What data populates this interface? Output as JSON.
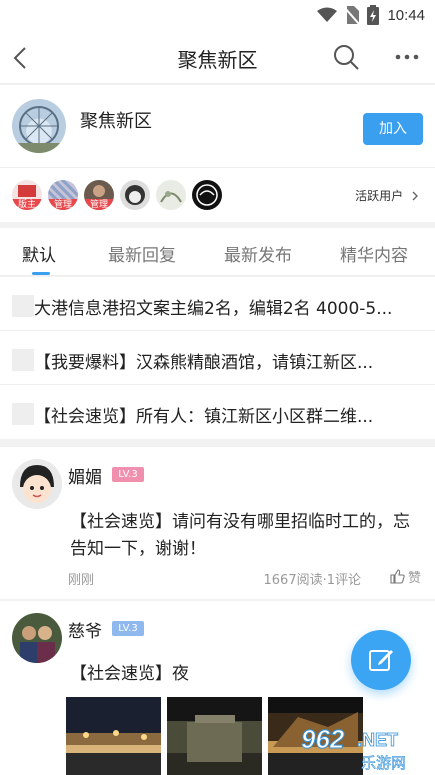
{
  "status_bar": {
    "time": "10:44"
  },
  "nav": {
    "title": "聚焦新区"
  },
  "forum": {
    "name": "聚焦新区",
    "join_label": "加入"
  },
  "members": {
    "badges": [
      "版主",
      "管理",
      "管理"
    ],
    "active_users_label": "活跃用户"
  },
  "tabs": [
    {
      "label": "默认"
    },
    {
      "label": "最新回复"
    },
    {
      "label": "最新发布"
    },
    {
      "label": "精华内容"
    }
  ],
  "pinned": [
    {
      "text": "大港信息港招文案主编2名，编辑2名 4000-5..."
    },
    {
      "text": "【我要爆料】汉森熊精酿酒馆，请镇江新区..."
    },
    {
      "text": "【社会速览】所有人：镇江新区小区群二维..."
    }
  ],
  "posts": [
    {
      "author": "媚媚",
      "level": "LV.3",
      "body": "【社会速览】请问有没有哪里招临时工的，忘告知一下，谢谢！",
      "time": "刚刚",
      "stats": "1667阅读·1评论",
      "like_label": "赞"
    },
    {
      "author": "慈爷",
      "level": "LV.3",
      "body": "【社会速览】夜"
    }
  ],
  "watermark": {
    "number": "962",
    "suffix": ".NET",
    "subtitle": "乐游网"
  },
  "colors": {
    "accent": "#3b9ff0",
    "badge_red": "#e8474b",
    "level_pink": "#f08fae",
    "level_blue": "#8fb8ee"
  }
}
